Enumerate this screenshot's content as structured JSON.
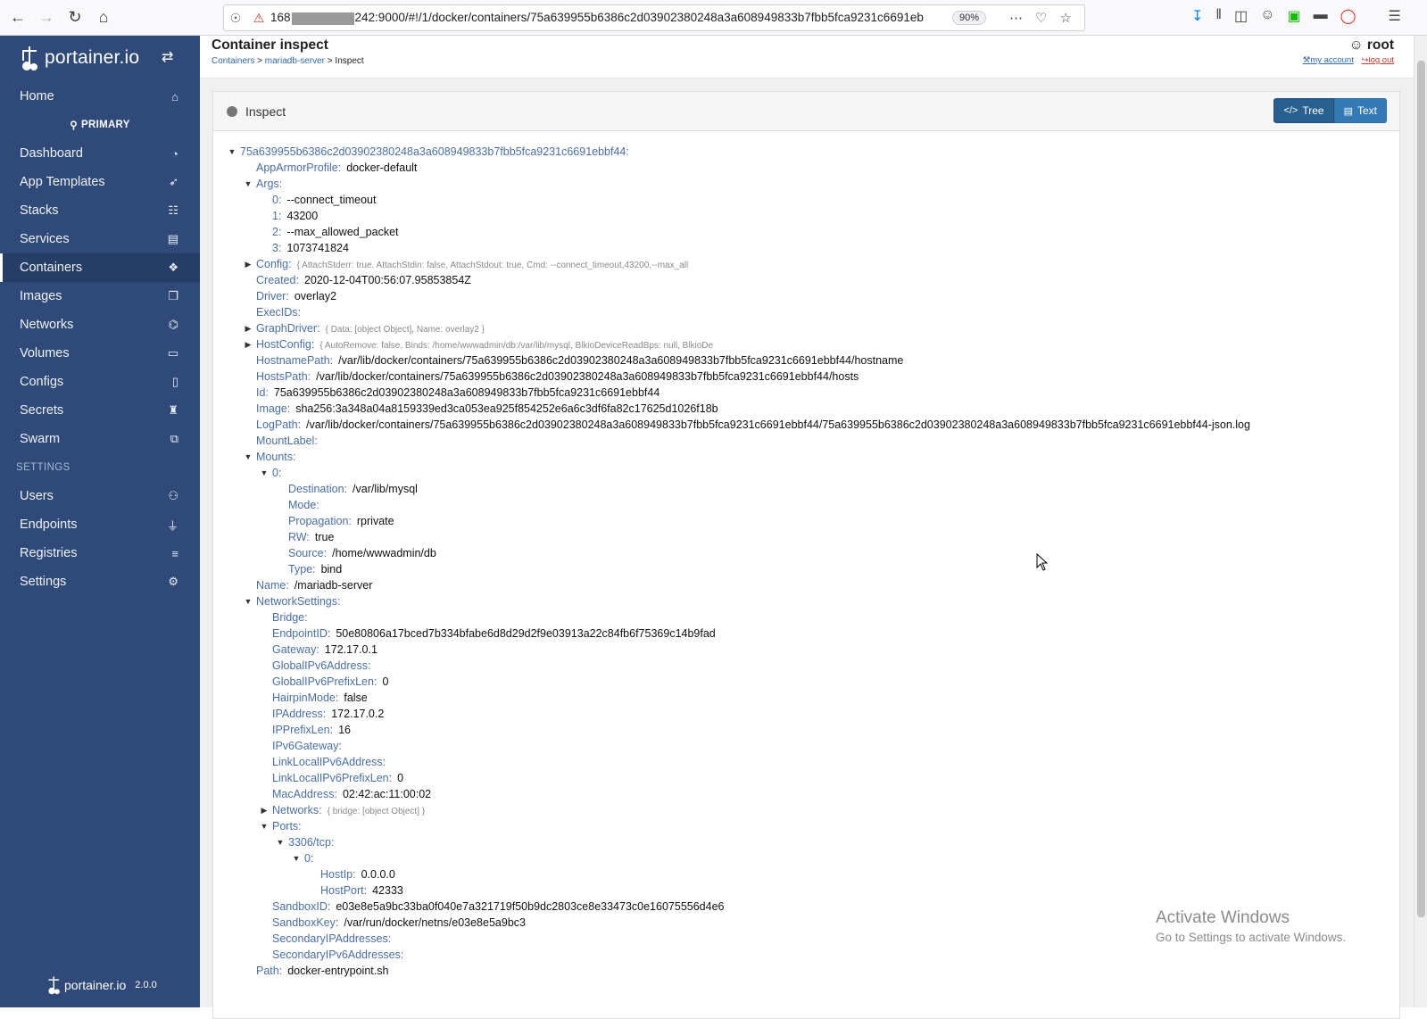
{
  "browser": {
    "url_prefix": "168",
    "url_suffix": "242:9000/#!/1/docker/containers/75a639955b6386c2d03902380248a3a608949833b7fbb5fca9231c6691eb",
    "zoom": "90%"
  },
  "sidebar": {
    "brand": "portainer.io",
    "items_top": [
      {
        "label": "Home",
        "icon": "home-icon",
        "glyph": "⌂"
      }
    ],
    "endpoint": "PRIMARY",
    "items_endpoint": [
      {
        "label": "Dashboard",
        "icon": "dashboard-icon",
        "glyph": "◔"
      },
      {
        "label": "App Templates",
        "icon": "rocket-icon",
        "glyph": "➶"
      },
      {
        "label": "Stacks",
        "icon": "th-list-icon",
        "glyph": "☷"
      },
      {
        "label": "Services",
        "icon": "list-alt-icon",
        "glyph": "▤"
      },
      {
        "label": "Containers",
        "icon": "cubes-icon",
        "glyph": "❖",
        "active": true
      },
      {
        "label": "Images",
        "icon": "clone-icon",
        "glyph": "❐"
      },
      {
        "label": "Networks",
        "icon": "sitemap-icon",
        "glyph": "⌬"
      },
      {
        "label": "Volumes",
        "icon": "hdd-icon",
        "glyph": "▭"
      },
      {
        "label": "Configs",
        "icon": "file-code-icon",
        "glyph": "▯"
      },
      {
        "label": "Secrets",
        "icon": "user-secret-icon",
        "glyph": "♜"
      },
      {
        "label": "Swarm",
        "icon": "object-group-icon",
        "glyph": "⧉"
      }
    ],
    "settings_heading": "SETTINGS",
    "items_settings": [
      {
        "label": "Users",
        "icon": "users-icon",
        "glyph": "⚇"
      },
      {
        "label": "Endpoints",
        "icon": "plug-icon",
        "glyph": "⏚"
      },
      {
        "label": "Registries",
        "icon": "database-icon",
        "glyph": "≡"
      },
      {
        "label": "Settings",
        "icon": "cogs-icon",
        "glyph": "⚙"
      }
    ],
    "footer_brand": "portainer.io",
    "version": "2.0.0"
  },
  "header": {
    "title": "Container inspect",
    "breadcrumb": [
      "Containers",
      "mariadb-server",
      "Inspect"
    ],
    "user": "root",
    "my_account": "my account",
    "log_out": "log out"
  },
  "panel": {
    "title": "Inspect",
    "btn_tree": "Tree",
    "btn_text": "Text"
  },
  "tree": [
    {
      "d": 0,
      "arrow": "open",
      "key": "75a639955b6386c2d03902380248a3a608949833b7fbb5fca9231c6691ebbf44:"
    },
    {
      "d": 1,
      "key": "AppArmorProfile:",
      "val": "docker-default"
    },
    {
      "d": 1,
      "arrow": "open",
      "key": "Args:"
    },
    {
      "d": 2,
      "key": "0:",
      "val": "--connect_timeout"
    },
    {
      "d": 2,
      "key": "1:",
      "val": "43200"
    },
    {
      "d": 2,
      "key": "2:",
      "val": "--max_allowed_packet"
    },
    {
      "d": 2,
      "key": "3:",
      "val": "1073741824"
    },
    {
      "d": 1,
      "arrow": "closed",
      "key": "Config:",
      "preview": "{ AttachStderr: true, AttachStdin: false, AttachStdout: true, Cmd: --connect_timeout,43200,--max_all"
    },
    {
      "d": 1,
      "key": "Created:",
      "val": "2020-12-04T00:56:07.95853854Z"
    },
    {
      "d": 1,
      "key": "Driver:",
      "val": "overlay2"
    },
    {
      "d": 1,
      "key": "ExecIDs:"
    },
    {
      "d": 1,
      "arrow": "closed",
      "key": "GraphDriver:",
      "preview": "{ Data: [object Object], Name: overlay2 }"
    },
    {
      "d": 1,
      "arrow": "closed",
      "key": "HostConfig:",
      "preview": "{ AutoRemove: false, Binds: /home/wwwadmin/db:/var/lib/mysql, BlkioDeviceReadBps: null, BlkioDe"
    },
    {
      "d": 1,
      "key": "HostnamePath:",
      "val": "/var/lib/docker/containers/75a639955b6386c2d03902380248a3a608949833b7fbb5fca9231c6691ebbf44/hostname"
    },
    {
      "d": 1,
      "key": "HostsPath:",
      "val": "/var/lib/docker/containers/75a639955b6386c2d03902380248a3a608949833b7fbb5fca9231c6691ebbf44/hosts"
    },
    {
      "d": 1,
      "key": "Id:",
      "val": "75a639955b6386c2d03902380248a3a608949833b7fbb5fca9231c6691ebbf44"
    },
    {
      "d": 1,
      "key": "Image:",
      "val": "sha256:3a348a04a8159339ed3ca053ea925f854252e6a6c3df6fa82c17625d1026f18b"
    },
    {
      "d": 1,
      "key": "LogPath:",
      "val": "/var/lib/docker/containers/75a639955b6386c2d03902380248a3a608949833b7fbb5fca9231c6691ebbf44/75a639955b6386c2d03902380248a3a608949833b7fbb5fca9231c6691ebbf44-json.log"
    },
    {
      "d": 1,
      "key": "MountLabel:"
    },
    {
      "d": 1,
      "arrow": "open",
      "key": "Mounts:"
    },
    {
      "d": 2,
      "arrow": "open",
      "key": "0:"
    },
    {
      "d": 3,
      "key": "Destination:",
      "val": "/var/lib/mysql"
    },
    {
      "d": 3,
      "key": "Mode:"
    },
    {
      "d": 3,
      "key": "Propagation:",
      "val": "rprivate"
    },
    {
      "d": 3,
      "key": "RW:",
      "val": "true"
    },
    {
      "d": 3,
      "key": "Source:",
      "val": "/home/wwwadmin/db"
    },
    {
      "d": 3,
      "key": "Type:",
      "val": "bind"
    },
    {
      "d": 1,
      "key": "Name:",
      "val": "/mariadb-server"
    },
    {
      "d": 1,
      "arrow": "open",
      "key": "NetworkSettings:"
    },
    {
      "d": 2,
      "key": "Bridge:"
    },
    {
      "d": 2,
      "key": "EndpointID:",
      "val": "50e80806a17bced7b334bfabe6d8d29d2f9e03913a22c84fb6f75369c14b9fad"
    },
    {
      "d": 2,
      "key": "Gateway:",
      "val": "172.17.0.1"
    },
    {
      "d": 2,
      "key": "GlobalIPv6Address:"
    },
    {
      "d": 2,
      "key": "GlobalIPv6PrefixLen:",
      "val": "0"
    },
    {
      "d": 2,
      "key": "HairpinMode:",
      "val": "false"
    },
    {
      "d": 2,
      "key": "IPAddress:",
      "val": "172.17.0.2"
    },
    {
      "d": 2,
      "key": "IPPrefixLen:",
      "val": "16"
    },
    {
      "d": 2,
      "key": "IPv6Gateway:"
    },
    {
      "d": 2,
      "key": "LinkLocalIPv6Address:"
    },
    {
      "d": 2,
      "key": "LinkLocalIPv6PrefixLen:",
      "val": "0"
    },
    {
      "d": 2,
      "key": "MacAddress:",
      "val": "02:42:ac:11:00:02"
    },
    {
      "d": 2,
      "arrow": "closed",
      "key": "Networks:",
      "preview": "{ bridge: [object Object] }"
    },
    {
      "d": 2,
      "arrow": "open",
      "key": "Ports:"
    },
    {
      "d": 3,
      "arrow": "open",
      "key": "3306/tcp:"
    },
    {
      "d": 4,
      "arrow": "open",
      "key": "0:"
    },
    {
      "d": 5,
      "key": "HostIp:",
      "val": "0.0.0.0"
    },
    {
      "d": 5,
      "key": "HostPort:",
      "val": "42333"
    },
    {
      "d": 2,
      "key": "SandboxID:",
      "val": "e03e8e5a9bc33ba0f040e7a321719f50b9dc2803ce8e33473c0e16075556d4e6"
    },
    {
      "d": 2,
      "key": "SandboxKey:",
      "val": "/var/run/docker/netns/e03e8e5a9bc3"
    },
    {
      "d": 2,
      "key": "SecondaryIPAddresses:"
    },
    {
      "d": 2,
      "key": "SecondaryIPv6Addresses:"
    },
    {
      "d": 1,
      "key": "Path:",
      "val": "docker-entrypoint.sh"
    }
  ],
  "watermark": {
    "line1": "Activate Windows",
    "line2": "Go to Settings to activate Windows."
  }
}
